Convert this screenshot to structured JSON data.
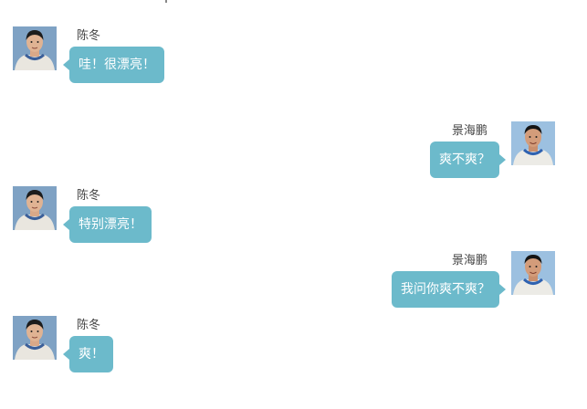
{
  "messages": [
    {
      "side": "left",
      "name": "陈冬",
      "text": "哇！很漂亮！",
      "avatar_icon": "astronaut-portrait-icon",
      "avatar_bg": "#7fa2c4"
    },
    {
      "side": "right",
      "name": "景海鹏",
      "text": "爽不爽？",
      "avatar_icon": "astronaut-portrait-icon",
      "avatar_bg": "#9cc0e0"
    },
    {
      "side": "left",
      "name": "陈冬",
      "text": "特别漂亮！",
      "avatar_icon": "astronaut-portrait-icon",
      "avatar_bg": "#7fa2c4"
    },
    {
      "side": "right",
      "name": "景海鹏",
      "text": "我问你爽不爽？",
      "avatar_icon": "astronaut-portrait-icon",
      "avatar_bg": "#9cc0e0"
    },
    {
      "side": "left",
      "name": "陈冬",
      "text": "爽！",
      "avatar_icon": "astronaut-portrait-icon",
      "avatar_bg": "#7fa2c4"
    }
  ],
  "colors": {
    "bubble": "#6cbacb",
    "bubble_text": "#ffffff",
    "name_text": "#444444"
  }
}
